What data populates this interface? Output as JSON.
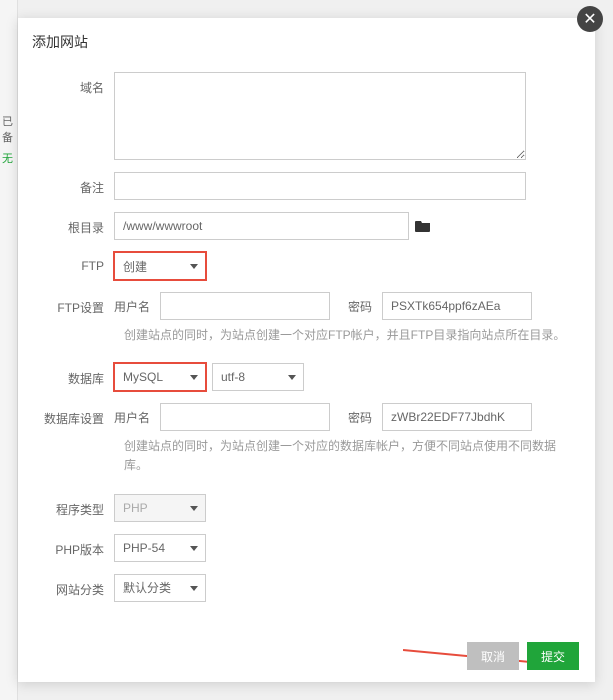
{
  "bg": {
    "t1": "已备",
    "t2": "无"
  },
  "modal": {
    "title": "添加网站"
  },
  "form": {
    "domain": {
      "label": "域名",
      "value": ""
    },
    "remark": {
      "label": "备注",
      "value": ""
    },
    "root": {
      "label": "根目录",
      "value": "/www/wwwroot"
    },
    "ftp": {
      "label": "FTP",
      "selected": "创建"
    },
    "ftp_settings": {
      "label": "FTP设置",
      "user_label": "用户名",
      "user_value": "",
      "pwd_label": "密码",
      "pwd_value": "PSXTk654ppf6zAEa",
      "hint": "创建站点的同时，为站点创建一个对应FTP帐户，并且FTP目录指向站点所在目录。"
    },
    "db": {
      "label": "数据库",
      "type_selected": "MySQL",
      "charset_selected": "utf-8"
    },
    "db_settings": {
      "label": "数据库设置",
      "user_label": "用户名",
      "user_value": "",
      "pwd_label": "密码",
      "pwd_value": "zWBr22EDF77JbdhK",
      "hint": "创建站点的同时，为站点创建一个对应的数据库帐户，方便不同站点使用不同数据库。"
    },
    "program": {
      "label": "程序类型",
      "selected": "PHP"
    },
    "php_ver": {
      "label": "PHP版本",
      "selected": "PHP-54"
    },
    "category": {
      "label": "网站分类",
      "selected": "默认分类"
    }
  },
  "footer": {
    "cancel": "取消",
    "submit": "提交"
  }
}
